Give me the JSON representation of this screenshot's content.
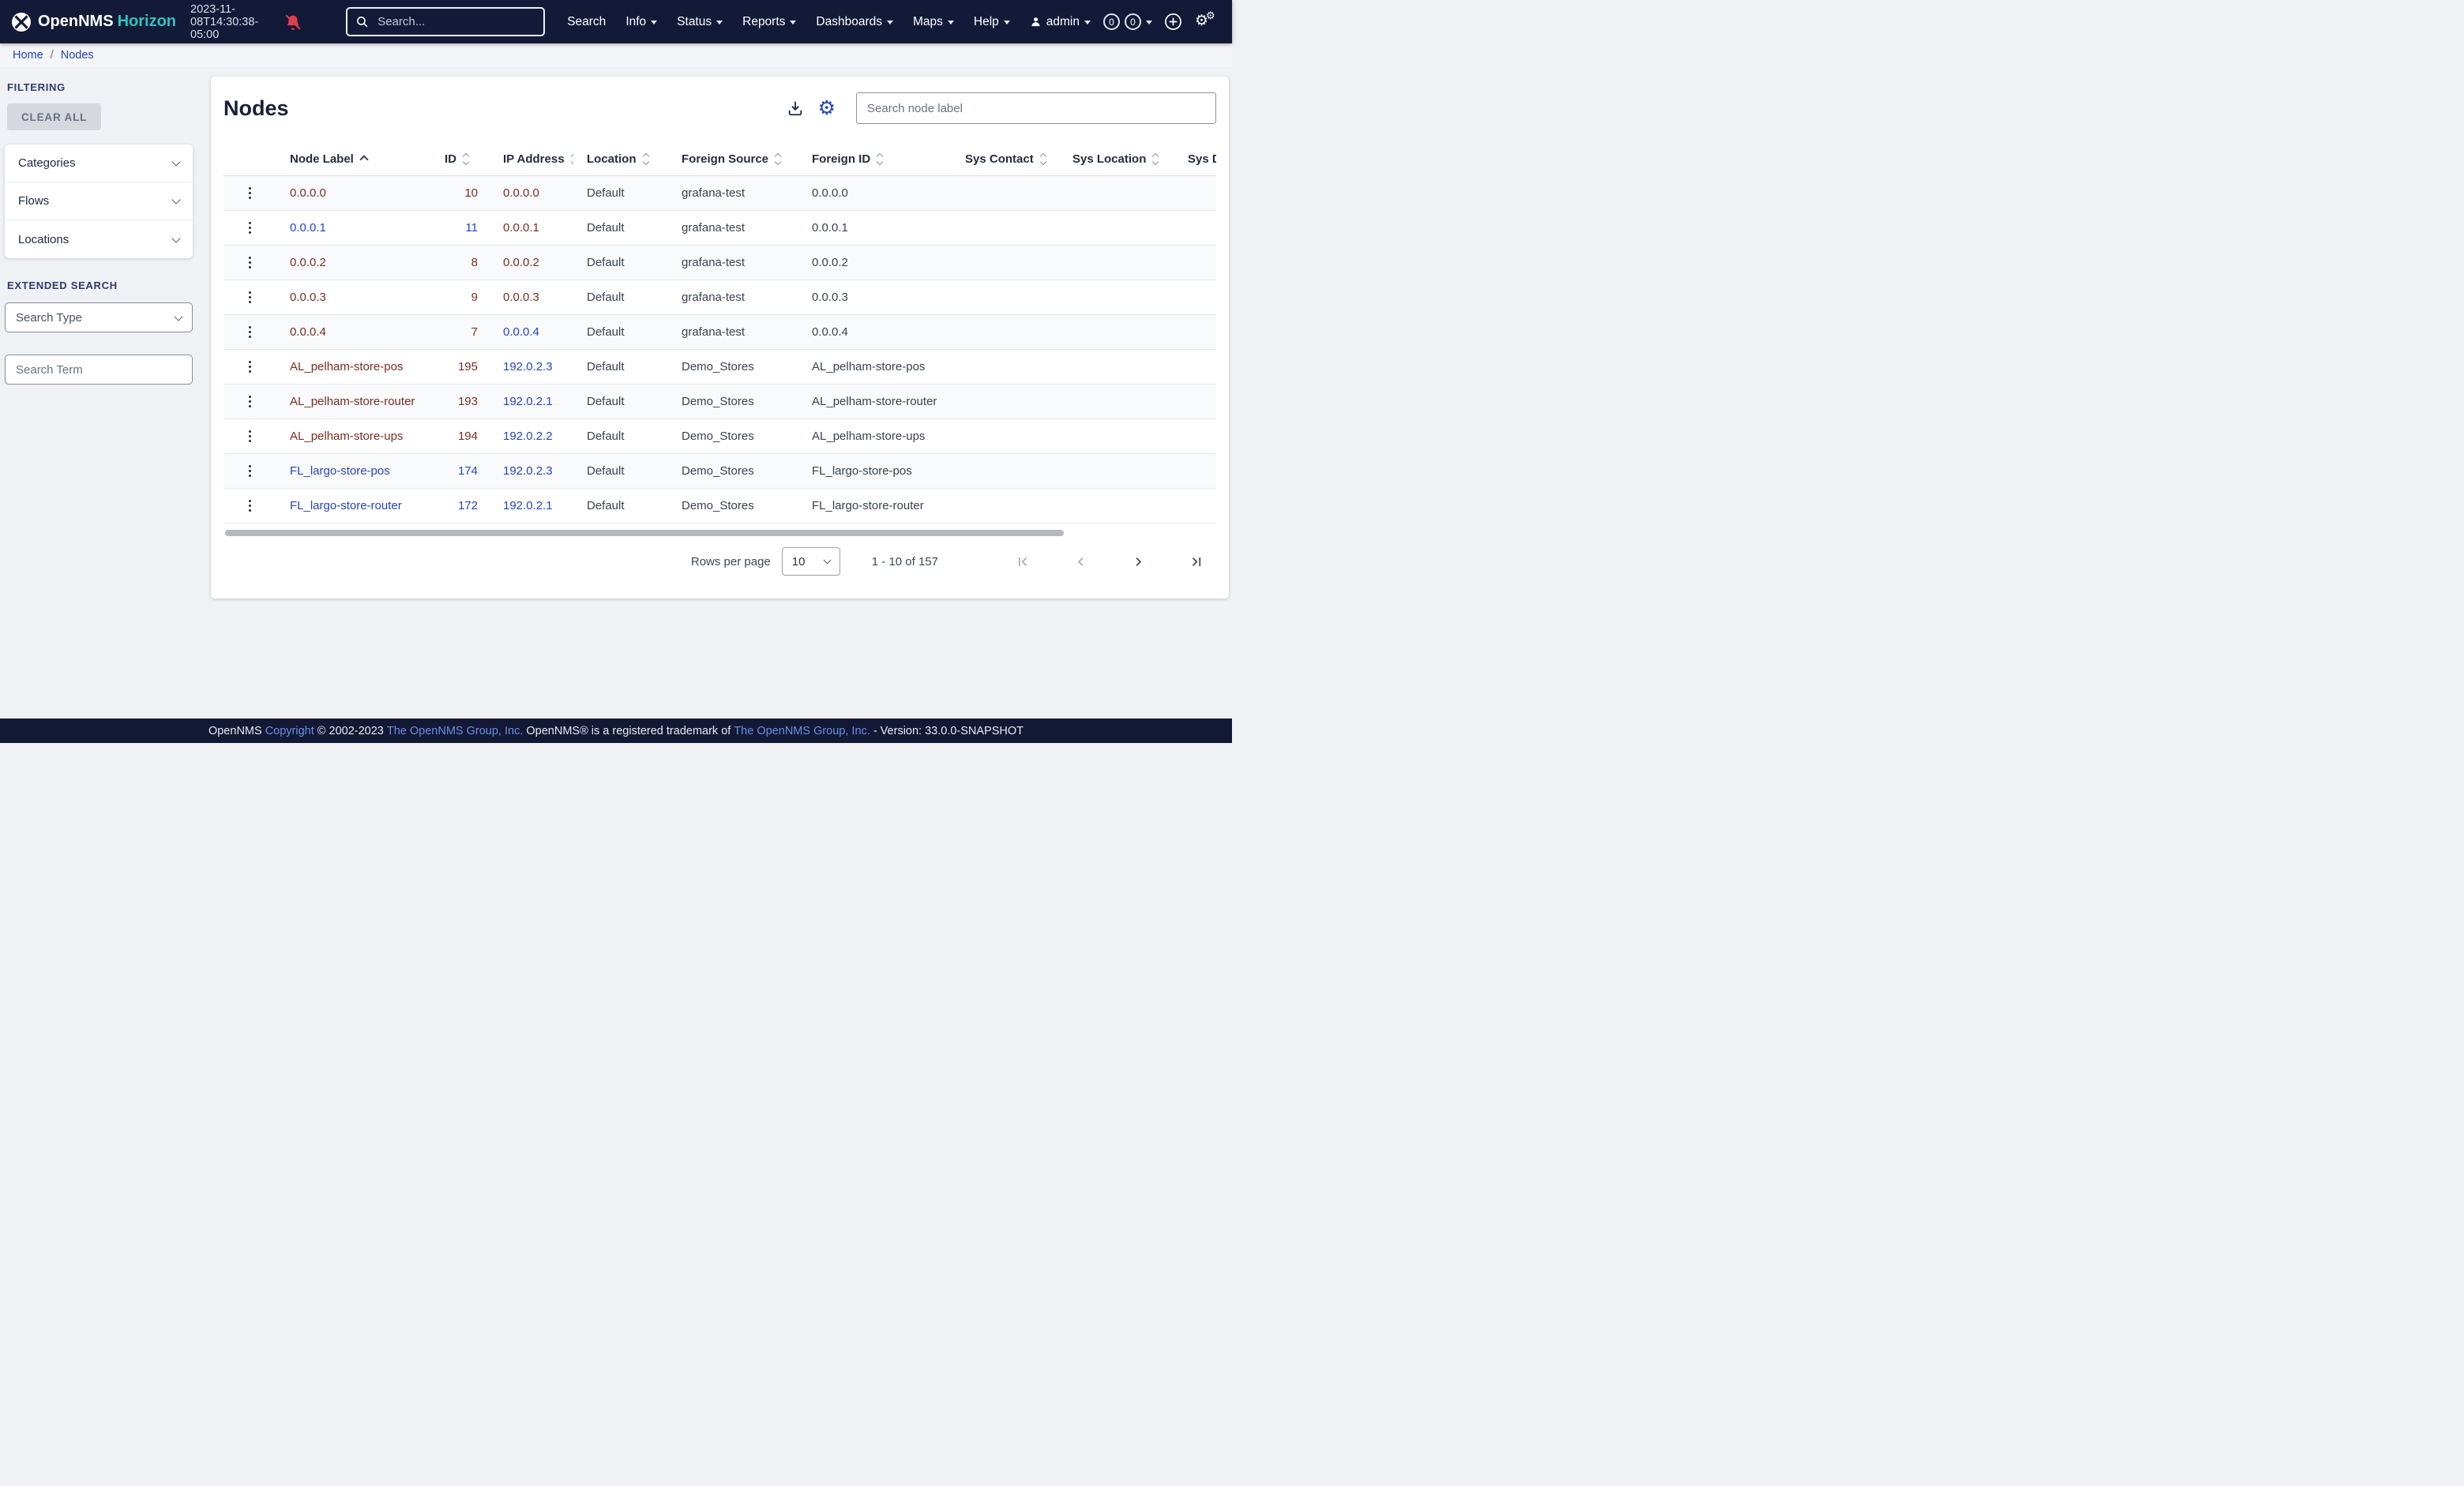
{
  "navbar": {
    "brand": "OpenNMS",
    "edition": "Horizon",
    "timestamp": "2023-11-08T14:30:38-05:00",
    "search_placeholder": "Search...",
    "menu": [
      {
        "label": "Search",
        "caretClass": "hide"
      },
      {
        "label": "Info",
        "caretClass": "show"
      },
      {
        "label": "Status",
        "caretClass": "show"
      },
      {
        "label": "Reports",
        "caretClass": "show"
      },
      {
        "label": "Dashboards",
        "caretClass": "show"
      },
      {
        "label": "Maps",
        "caretClass": "show"
      },
      {
        "label": "Help",
        "caretClass": "show"
      }
    ],
    "user": {
      "label": "admin"
    },
    "notification_badges": [
      {
        "count": "0"
      },
      {
        "count": "0"
      }
    ]
  },
  "breadcrumb": {
    "home": "Home",
    "separator": "/",
    "current": "Nodes"
  },
  "sidebar": {
    "filtering_label": "FILTERING",
    "clear_all_label": "CLEAR ALL",
    "filters": [
      {
        "label": "Categories"
      },
      {
        "label": "Flows"
      },
      {
        "label": "Locations"
      }
    ],
    "extended_search_label": "EXTENDED SEARCH",
    "search_type_placeholder": "Search Type",
    "search_term_placeholder": "Search Term"
  },
  "main": {
    "title": "Nodes",
    "node_search_placeholder": "Search node label",
    "table": {
      "columns": [
        {
          "label": "",
          "sort": "blank"
        },
        {
          "label": "Node Label",
          "sort": "asc"
        },
        {
          "label": "ID",
          "sort": "both"
        },
        {
          "label": "IP Address",
          "sort": "both"
        },
        {
          "label": "Location",
          "sort": "both"
        },
        {
          "label": "Foreign Source",
          "sort": "both"
        },
        {
          "label": "Foreign ID",
          "sort": "both"
        },
        {
          "label": "Sys Contact",
          "sort": "both"
        },
        {
          "label": "Sys Location",
          "sort": "both"
        },
        {
          "label": "Sys Description",
          "sort": "both"
        }
      ],
      "rows": [
        {
          "label": "0.0.0.0",
          "labelClass": "visited",
          "id": "10",
          "idClass": "visited",
          "ip": "0.0.0.0",
          "ipClass": "visited",
          "location": "Default",
          "foreignSource": "grafana-test",
          "foreignId": "0.0.0.0"
        },
        {
          "label": "0.0.0.1",
          "labelClass": "link",
          "id": "11",
          "idClass": "link",
          "ip": "0.0.0.1",
          "ipClass": "visited",
          "location": "Default",
          "foreignSource": "grafana-test",
          "foreignId": "0.0.0.1"
        },
        {
          "label": "0.0.0.2",
          "labelClass": "visited",
          "id": "8",
          "idClass": "visited",
          "ip": "0.0.0.2",
          "ipClass": "visited",
          "location": "Default",
          "foreignSource": "grafana-test",
          "foreignId": "0.0.0.2"
        },
        {
          "label": "0.0.0.3",
          "labelClass": "visited",
          "id": "9",
          "idClass": "visited",
          "ip": "0.0.0.3",
          "ipClass": "visited",
          "location": "Default",
          "foreignSource": "grafana-test",
          "foreignId": "0.0.0.3"
        },
        {
          "label": "0.0.0.4",
          "labelClass": "visited",
          "id": "7",
          "idClass": "visited",
          "ip": "0.0.0.4",
          "ipClass": "link",
          "location": "Default",
          "foreignSource": "grafana-test",
          "foreignId": "0.0.0.4"
        },
        {
          "label": "AL_pelham-store-pos",
          "labelClass": "visited",
          "id": "195",
          "idClass": "visited",
          "ip": "192.0.2.3",
          "ipClass": "link",
          "location": "Default",
          "foreignSource": "Demo_Stores",
          "foreignId": "AL_pelham-store-pos"
        },
        {
          "label": "AL_pelham-store-router",
          "labelClass": "visited",
          "id": "193",
          "idClass": "visited",
          "ip": "192.0.2.1",
          "ipClass": "link",
          "location": "Default",
          "foreignSource": "Demo_Stores",
          "foreignId": "AL_pelham-store-router"
        },
        {
          "label": "AL_pelham-store-ups",
          "labelClass": "visited",
          "id": "194",
          "idClass": "visited",
          "ip": "192.0.2.2",
          "ipClass": "link",
          "location": "Default",
          "foreignSource": "Demo_Stores",
          "foreignId": "AL_pelham-store-ups"
        },
        {
          "label": "FL_largo-store-pos",
          "labelClass": "link",
          "id": "174",
          "idClass": "link",
          "ip": "192.0.2.3",
          "ipClass": "link",
          "location": "Default",
          "foreignSource": "Demo_Stores",
          "foreignId": "FL_largo-store-pos"
        },
        {
          "label": "FL_largo-store-router",
          "labelClass": "link",
          "id": "172",
          "idClass": "link",
          "ip": "192.0.2.1",
          "ipClass": "link",
          "location": "Default",
          "foreignSource": "Demo_Stores",
          "foreignId": "FL_largo-store-router"
        }
      ]
    },
    "pagination": {
      "rows_per_page_label": "Rows per page",
      "rows_per_page_value": "10",
      "range_label": "1 - 10 of 157"
    }
  },
  "footer": {
    "segments": [
      {
        "text": "OpenNMS ",
        "type": "plain",
        "interactable": "false"
      },
      {
        "text": "Copyright",
        "type": "link",
        "interactable": "true"
      },
      {
        "text": " © 2002-2023 ",
        "type": "plain",
        "interactable": "false"
      },
      {
        "text": "The OpenNMS Group, Inc.",
        "type": "link",
        "interactable": "true"
      },
      {
        "text": " OpenNMS® is a registered trademark of ",
        "type": "plain",
        "interactable": "false"
      },
      {
        "text": "The OpenNMS Group, Inc.",
        "type": "link",
        "interactable": "true"
      },
      {
        "text": " - Version: 33.0.0-SNAPSHOT",
        "type": "plain",
        "interactable": "false"
      }
    ]
  },
  "colors": {
    "navbar_bg": "#131a38",
    "accent_teal": "#2cc5c0",
    "link_blue": "#2444c4",
    "visited_maroon": "#7b2d21",
    "alert_red": "#d7404e"
  }
}
